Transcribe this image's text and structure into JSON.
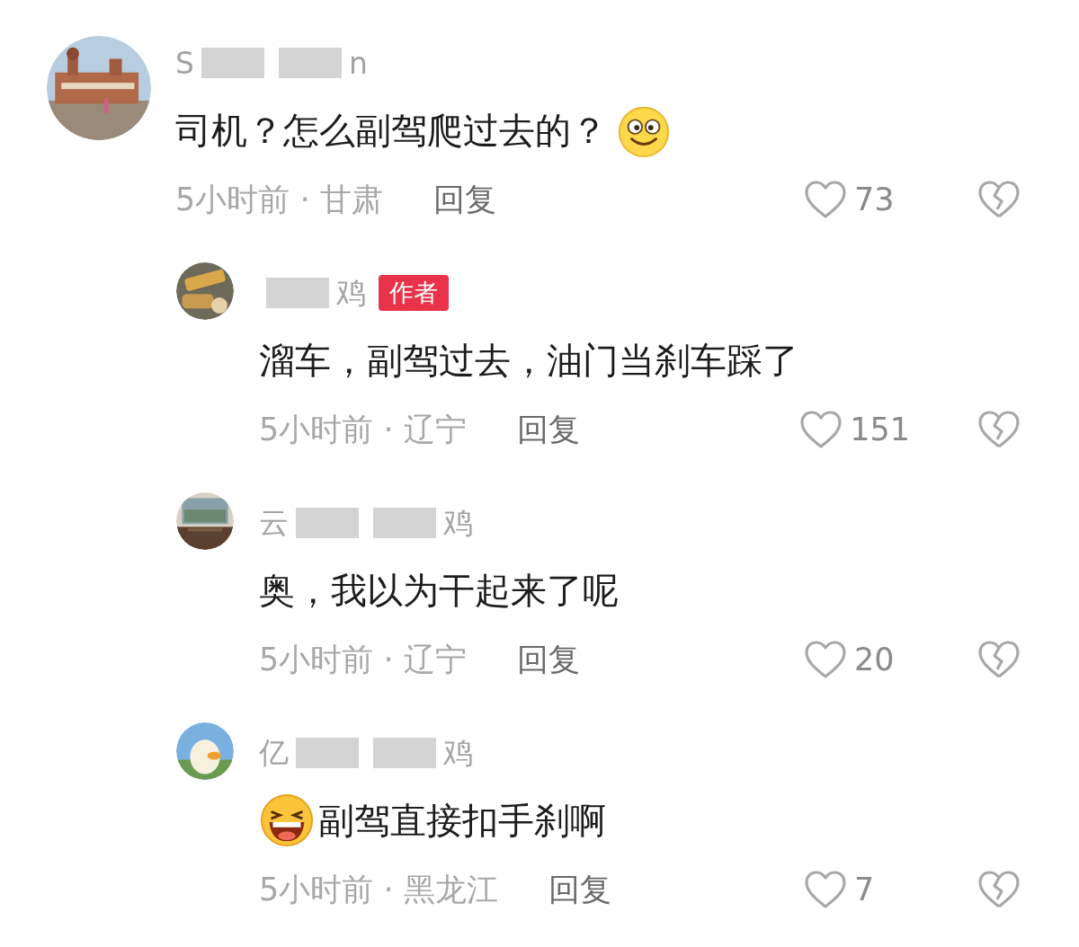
{
  "comments": [
    {
      "kind": "top",
      "name": [
        {
          "kind": "text",
          "text": "S"
        },
        {
          "kind": "redacted"
        },
        {
          "kind": "redacted"
        },
        {
          "kind": "text",
          "text": "n"
        }
      ],
      "author": false,
      "content": [
        {
          "kind": "text",
          "text": "司机？怎么副驾爬过去的？"
        },
        {
          "kind": "smile-emoji"
        }
      ],
      "time": "5小时前 · 甘肃",
      "reply": "回复",
      "likes": "73"
    },
    {
      "kind": "reply",
      "name": [
        {
          "kind": "redacted"
        },
        {
          "kind": "text",
          "text": "鸡"
        }
      ],
      "author": true,
      "author_label": "作者",
      "content": [
        {
          "kind": "text",
          "text": "溜车，副驾过去，油门当刹车踩了"
        }
      ],
      "time": "5小时前 · 辽宁",
      "reply": "回复",
      "likes": "151"
    },
    {
      "kind": "reply",
      "name": [
        {
          "kind": "text",
          "text": "云"
        },
        {
          "kind": "redacted"
        },
        {
          "kind": "redacted"
        },
        {
          "kind": "text",
          "text": "鸡"
        }
      ],
      "author": false,
      "content": [
        {
          "kind": "text",
          "text": "奥，我以为干起来了呢"
        }
      ],
      "time": "5小时前 · 辽宁",
      "reply": "回复",
      "likes": "20"
    },
    {
      "kind": "reply",
      "name": [
        {
          "kind": "text",
          "text": "亿"
        },
        {
          "kind": "redacted"
        },
        {
          "kind": "redacted"
        },
        {
          "kind": "text",
          "text": "鸡"
        }
      ],
      "author": false,
      "content": [
        {
          "kind": "laugh-emoji"
        },
        {
          "kind": "text",
          "text": "副驾直接扣手刹啊"
        }
      ],
      "time": "5小时前 · 黑龙江",
      "reply": "回复",
      "likes": "7"
    }
  ]
}
